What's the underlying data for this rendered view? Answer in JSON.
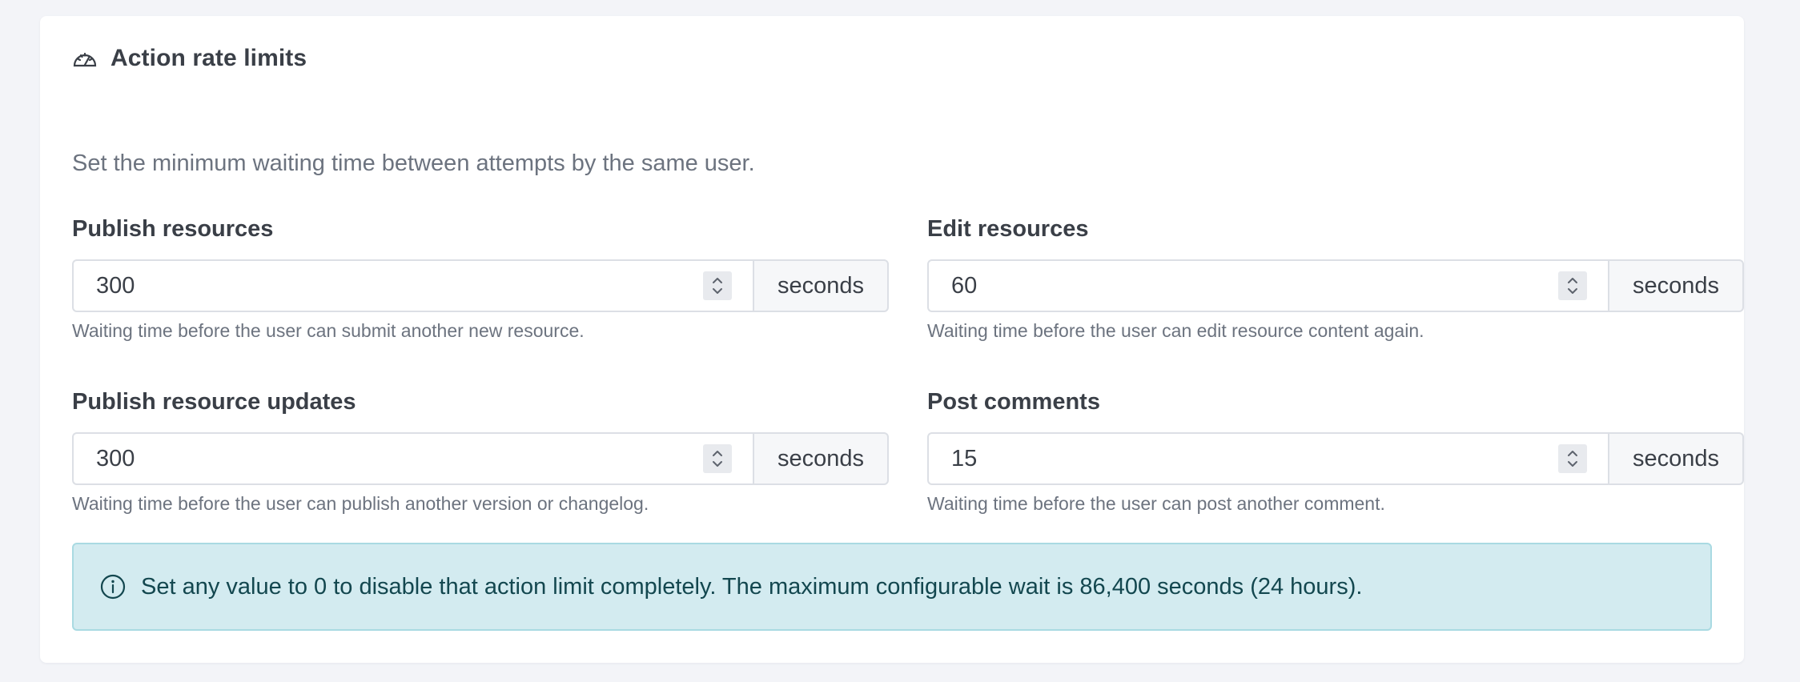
{
  "card": {
    "title": "Action rate limits",
    "icon": "gauge-icon",
    "description": "Set the minimum waiting time between attempts by the same user."
  },
  "fields": {
    "publish_resources": {
      "label": "Publish resources",
      "value": "300",
      "unit": "seconds",
      "help": "Waiting time before the user can submit another new resource."
    },
    "edit_resources": {
      "label": "Edit resources",
      "value": "60",
      "unit": "seconds",
      "help": "Waiting time before the user can edit resource content again."
    },
    "publish_updates": {
      "label": "Publish resource updates",
      "value": "300",
      "unit": "seconds",
      "help": "Waiting time before the user can publish another version or changelog."
    },
    "post_comments": {
      "label": "Post comments",
      "value": "15",
      "unit": "seconds",
      "help": "Waiting time before the user can post another comment."
    }
  },
  "alert": {
    "icon": "info-icon",
    "text": "Set any value to 0 to disable that action limit completely. The maximum configurable wait is 86,400 seconds (24 hours)."
  },
  "colors": {
    "page_background": "#f3f4f8",
    "card_background": "#ffffff",
    "alert_background": "#d3ebf0",
    "alert_border": "#a9dae2",
    "alert_text": "#13474f"
  }
}
